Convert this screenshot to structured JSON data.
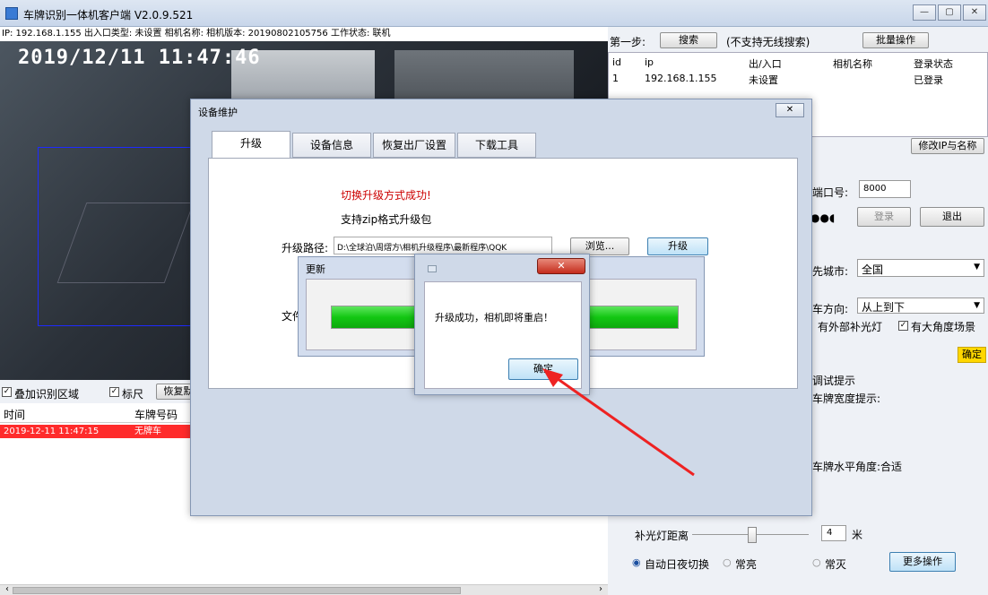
{
  "window": {
    "title": "车牌识别一体机客户端 V2.0.9.521",
    "min": "—",
    "max": "▢",
    "close": "✕"
  },
  "infobar": "IP: 192.168.1.155 出入口类型: 未设置 相机名称:  相机版本: 20190802105756 工作状态: 联机",
  "video": {
    "timestamp": "2019/12/11  11:47:46"
  },
  "bottom_controls": {
    "overlay_label": "叠加识别区域",
    "ruler_label": "标尺",
    "restore_button": "恢复默"
  },
  "log": {
    "headers": [
      "时间",
      "车牌号码"
    ],
    "rows": [
      {
        "time": "2019-12-11 11:47:15",
        "plate": "无牌车"
      }
    ]
  },
  "right": {
    "step_label": "第一步:",
    "search_button": "搜索",
    "search_note": "(不支持无线搜索)",
    "batch_button": "批量操作",
    "columns": [
      "id",
      "ip",
      "出/入口",
      "相机名称",
      "登录状态"
    ],
    "rows": [
      {
        "id": "1",
        "ip": "192.168.1.155",
        "direction": "未设置",
        "name": "",
        "status": "已登录"
      }
    ],
    "modify_button": "修改IP与名称",
    "port_label": "端口号:",
    "port_value": "8000",
    "login_button": "登录",
    "logout_button": "退出",
    "city_label": "先城市:",
    "city_value": "全国",
    "dir_label": "车方向:",
    "dir_value": "从上到下",
    "external_light": "有外部补光灯",
    "wide_angle": "有大角度场景",
    "confirm_button": "确定",
    "debug_hint": "调试提示",
    "plate_width_hint": "车牌宽度提示:",
    "plate_angle_label": "车牌水平角度:",
    "plate_angle_value": "合适",
    "light_distance_label": "补光灯距离",
    "light_distance_value": "4",
    "light_distance_unit": "米",
    "radio_auto": "自动日夜切换",
    "radio_on": "常亮",
    "radio_off": "常灭",
    "more_button": "更多操作"
  },
  "dialog": {
    "title": "设备维护",
    "tabs": [
      "升级",
      "设备信息",
      "恢复出厂设置",
      "下载工具"
    ],
    "success_msg": "切换升级方式成功!",
    "format_msg": "支持zip格式升级包",
    "path_label": "升级路径:",
    "path_value": "D:\\全球泊\\周熠方\\相机升级程序\\最新程序\\QQK",
    "browse_button": "浏览...",
    "upgrade_button": "升级",
    "file_label": "文件"
  },
  "progress": {
    "title": "更新",
    "fill": 1.0
  },
  "msgbox": {
    "text": "升级成功，相机即将重启！",
    "ok_button": "确定"
  },
  "colors": {
    "red_row": "#ff2b2b",
    "progress_green": "#13c713",
    "accent": "#e22"
  }
}
